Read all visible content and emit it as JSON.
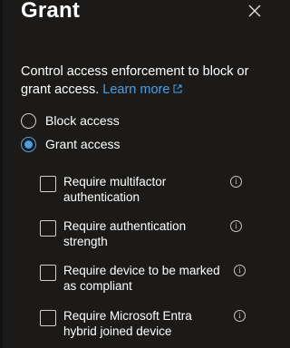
{
  "panel": {
    "title": "Grant",
    "description": "Control access enforcement to block or grant access.",
    "learn_more": "Learn more"
  },
  "options": {
    "block": {
      "label": "Block access",
      "selected": false
    },
    "grant": {
      "label": "Grant access",
      "selected": true
    }
  },
  "requirements": [
    {
      "label": "Require multifactor authentication",
      "checked": false
    },
    {
      "label": "Require authentication strength",
      "checked": false
    },
    {
      "label": "Require device to be marked as compliant",
      "checked": false
    },
    {
      "label": "Require Microsoft Entra hybrid joined device",
      "checked": false
    }
  ],
  "icons": {
    "close": "close-icon",
    "external": "external-link-icon",
    "info": "info-icon"
  },
  "colors": {
    "accent": "#4aa0e6",
    "background": "#1b1a19"
  }
}
